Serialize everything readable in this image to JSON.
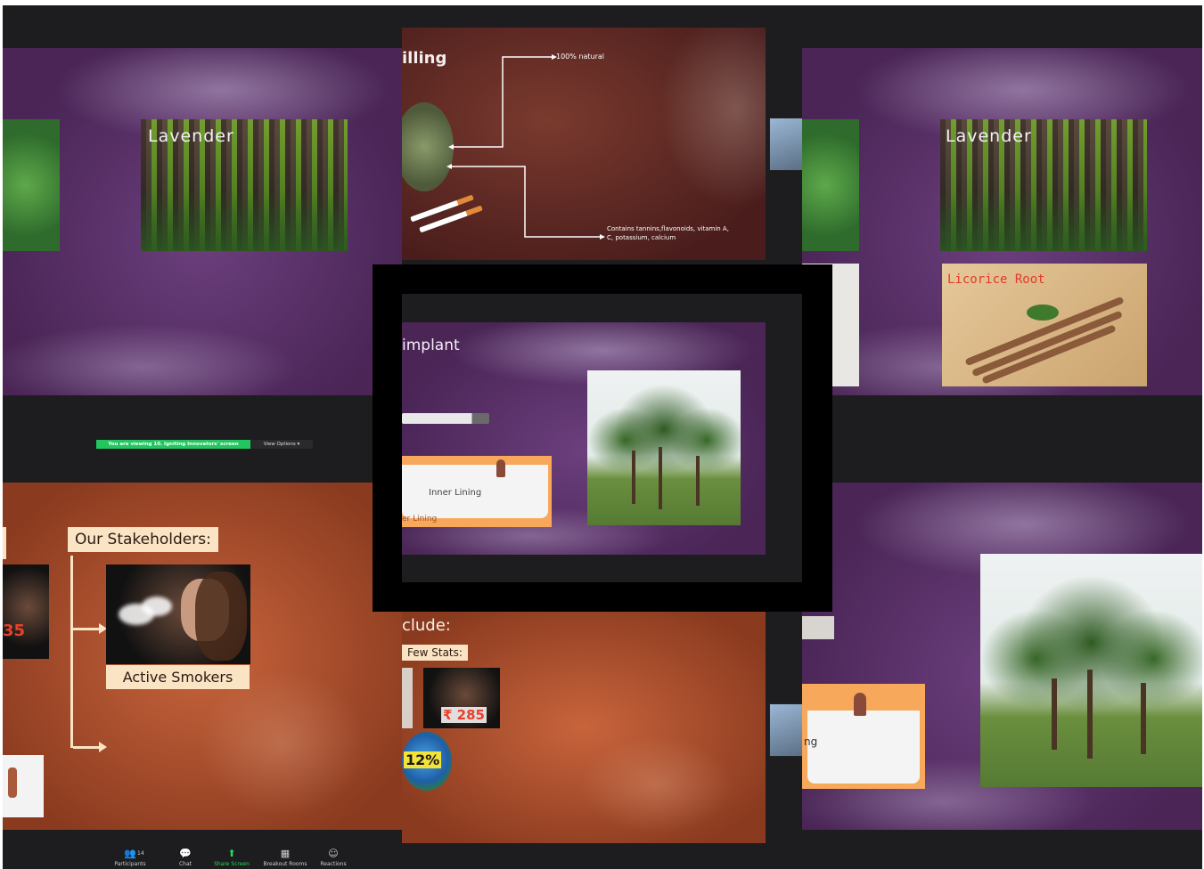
{
  "top_left": {
    "lavender_label": "Lavender"
  },
  "top_middle": {
    "title": "illing",
    "arrow_label_top": "100% natural",
    "arrow_label_bottom": "Contains tannins,flavonoids, vitamin A, C, potassium, calcium"
  },
  "top_right": {
    "lavender_label": "Lavender",
    "licorice_label": "Licorice Root"
  },
  "center": {
    "title": "implant",
    "inner_lining": "Inner Lining",
    "outer_lining": "er Lining"
  },
  "viewing_banner": {
    "text": "You are viewing 10. Igniting Innovators' screen",
    "view_options": "View Options"
  },
  "bottom_left": {
    "stakeholders_title": "Our Stakeholders:",
    "active_smokers": "Active Smokers",
    "cut_price": "35"
  },
  "bottom_middle": {
    "title": "clude:",
    "few_stats": "Few Stats:",
    "price": "₹ 285",
    "percent": "12%"
  },
  "bottom_right": {
    "lining": "ng"
  },
  "toolbar": {
    "participants_label": "Participants",
    "participants_count": "14",
    "chat_label": "Chat",
    "share_label": "Share Screen",
    "breakout_label": "Breakout Rooms",
    "reactions_label": "Reactions"
  },
  "colors": {
    "share_green": "#23d959",
    "banner_green": "#22c55e",
    "dark_bg": "#1d1d1f"
  }
}
